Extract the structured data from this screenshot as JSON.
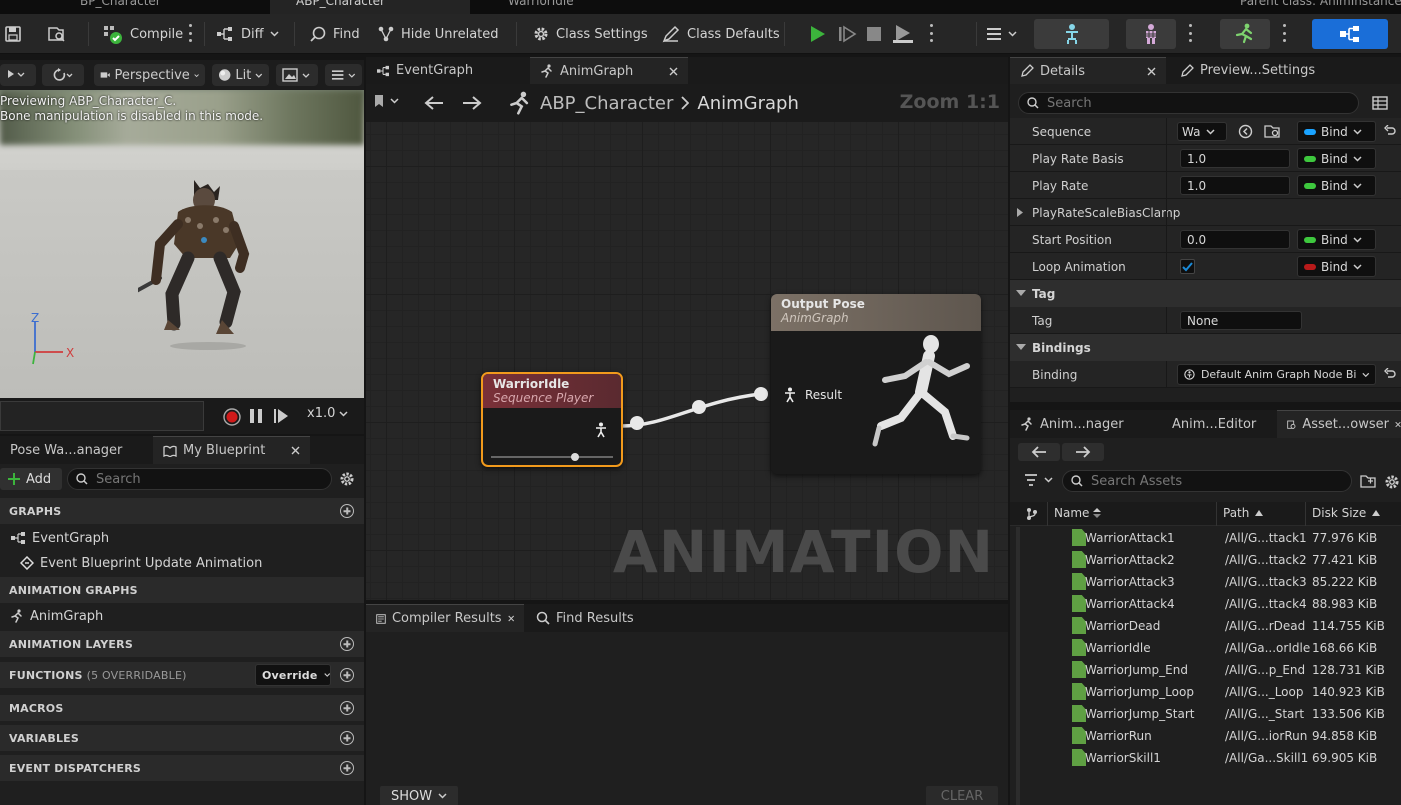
{
  "top_tabs": [
    "BP_Character",
    "ABP_Character",
    "WarriorIdle"
  ],
  "top_right_text": "Parent class: AnimInstance",
  "toolbar": {
    "compile": "Compile",
    "diff": "Diff",
    "find": "Find",
    "hide_unrelated": "Hide Unrelated",
    "class_settings": "Class Settings",
    "class_defaults": "Class Defaults"
  },
  "viewport": {
    "perspective": "Perspective",
    "lit": "Lit",
    "info_line1": "Previewing ABP_Character_C.",
    "info_line2": "Bone manipulation is disabled in this mode.",
    "axis_z": "Z",
    "axis_x": "X",
    "speed": "x1.0"
  },
  "left_tabs": [
    "Pose Wa...anager",
    "My Blueprint"
  ],
  "my_blueprint": {
    "add": "Add",
    "search_placeholder": "Search",
    "sections": {
      "graphs": "GRAPHS",
      "animation_graphs": "ANIMATION GRAPHS",
      "animation_layers": "ANIMATION LAYERS",
      "functions": "FUNCTIONS",
      "functions_note": "(5 OVERRIDABLE)",
      "override": "Override",
      "macros": "MACROS",
      "variables": "VARIABLES",
      "event_dispatchers": "EVENT DISPATCHERS"
    },
    "items": {
      "event_graph": "EventGraph",
      "event_update": "Event Blueprint Update Animation",
      "anim_graph": "AnimGraph"
    }
  },
  "graph": {
    "tabs": [
      "EventGraph",
      "AnimGraph"
    ],
    "breadcrumb_root": "ABP_Character",
    "breadcrumb_leaf": "AnimGraph",
    "zoom": "Zoom 1:1",
    "watermark": "ANIMATION",
    "node_warrior": {
      "title": "WarriorIdle",
      "subtitle": "Sequence Player"
    },
    "node_output": {
      "title": "Output Pose",
      "subtitle": "AnimGraph",
      "pin": "Result"
    }
  },
  "bottom": {
    "tabs": [
      "Compiler Results",
      "Find Results"
    ],
    "show": "SHOW",
    "clear": "CLEAR"
  },
  "details": {
    "tabs": [
      "Details",
      "Preview...Settings"
    ],
    "search_placeholder": "Search",
    "bind": "Bind",
    "rows": {
      "sequence": "Sequence",
      "sequence_value": "Wa",
      "play_rate_basis": "Play Rate Basis",
      "play_rate_basis_value": "1.0",
      "play_rate": "Play Rate",
      "play_rate_value": "1.0",
      "scale_bias": "PlayRateScaleBiasClamp",
      "start_position": "Start Position",
      "start_position_value": "0.0",
      "loop_animation": "Loop Animation"
    },
    "tag_section": "Tag",
    "tag_label": "Tag",
    "tag_value": "None",
    "bindings_section": "Bindings",
    "binding_label": "Binding",
    "binding_value": "Default Anim Graph Node Bi"
  },
  "content_browser": {
    "tabs": [
      "Anim...nager",
      "Anim...Editor",
      "Asset...owser"
    ],
    "search_placeholder": "Search Assets",
    "columns": {
      "name": "Name",
      "path": "Path",
      "size": "Disk Size"
    },
    "rows": [
      {
        "name": "WarriorAttack1",
        "path": "/All/G...ttack1",
        "size": "77.976 KiB"
      },
      {
        "name": "WarriorAttack2",
        "path": "/All/G...ttack2",
        "size": "77.421 KiB"
      },
      {
        "name": "WarriorAttack3",
        "path": "/All/G...ttack3",
        "size": "85.222 KiB"
      },
      {
        "name": "WarriorAttack4",
        "path": "/All/G...ttack4",
        "size": "88.983 KiB"
      },
      {
        "name": "WarriorDead",
        "path": "/All/G...rDead",
        "size": "114.755 KiB"
      },
      {
        "name": "WarriorIdle",
        "path": "/All/Ga...orIdle",
        "size": "168.66 KiB"
      },
      {
        "name": "WarriorJump_End",
        "path": "/All/G...p_End",
        "size": "128.731 KiB"
      },
      {
        "name": "WarriorJump_Loop",
        "path": "/All/G..._Loop",
        "size": "140.923 KiB"
      },
      {
        "name": "WarriorJump_Start",
        "path": "/All/G..._Start",
        "size": "133.506 KiB"
      },
      {
        "name": "WarriorRun",
        "path": "/All/G...iorRun",
        "size": "94.858 KiB"
      },
      {
        "name": "WarriorSkill1",
        "path": "/All/Ga...Skill1",
        "size": "69.905 KiB"
      }
    ]
  },
  "colors": {
    "accent_blue": "#1a6ed8",
    "play_green": "#3cb43c",
    "node_selected": "#f29a1c",
    "bind_blue": "#1aa3ff",
    "bind_green": "#3ec83e",
    "bind_red": "#b81a1a",
    "asset_green": "#5fa043"
  }
}
